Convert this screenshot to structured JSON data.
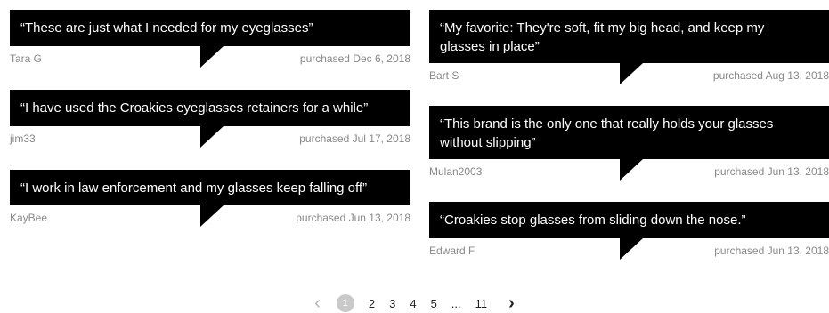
{
  "reviews_left": [
    {
      "quote": "“These are just what I needed for my eyeglasses”",
      "author": "Tara G",
      "purchased": "purchased Dec 6, 2018"
    },
    {
      "quote": "“I have used the Croakies eyeglasses retainers for a while”",
      "author": "jim33",
      "purchased": "purchased Jul 17, 2018"
    },
    {
      "quote": "“I work in law enforcement and my glasses keep falling off”",
      "author": "KayBee",
      "purchased": "purchased Jun 13, 2018"
    }
  ],
  "reviews_right": [
    {
      "quote": "“My favorite: They're soft, fit my big head, and keep my glasses in place”",
      "author": "Bart S",
      "purchased": "purchased Aug 13, 2018"
    },
    {
      "quote": "“This brand is the only one that really holds your glasses without slipping”",
      "author": "Mulan2003",
      "purchased": "purchased Jun 13, 2018"
    },
    {
      "quote": "“Croakies stop glasses from sliding down the nose.”",
      "author": "Edward F",
      "purchased": "purchased Jun 13, 2018"
    }
  ],
  "pagination": {
    "prev_icon": "‹",
    "current": "1",
    "pages": [
      "2",
      "3",
      "4",
      "5",
      "...",
      "11"
    ],
    "next_icon": "›"
  }
}
